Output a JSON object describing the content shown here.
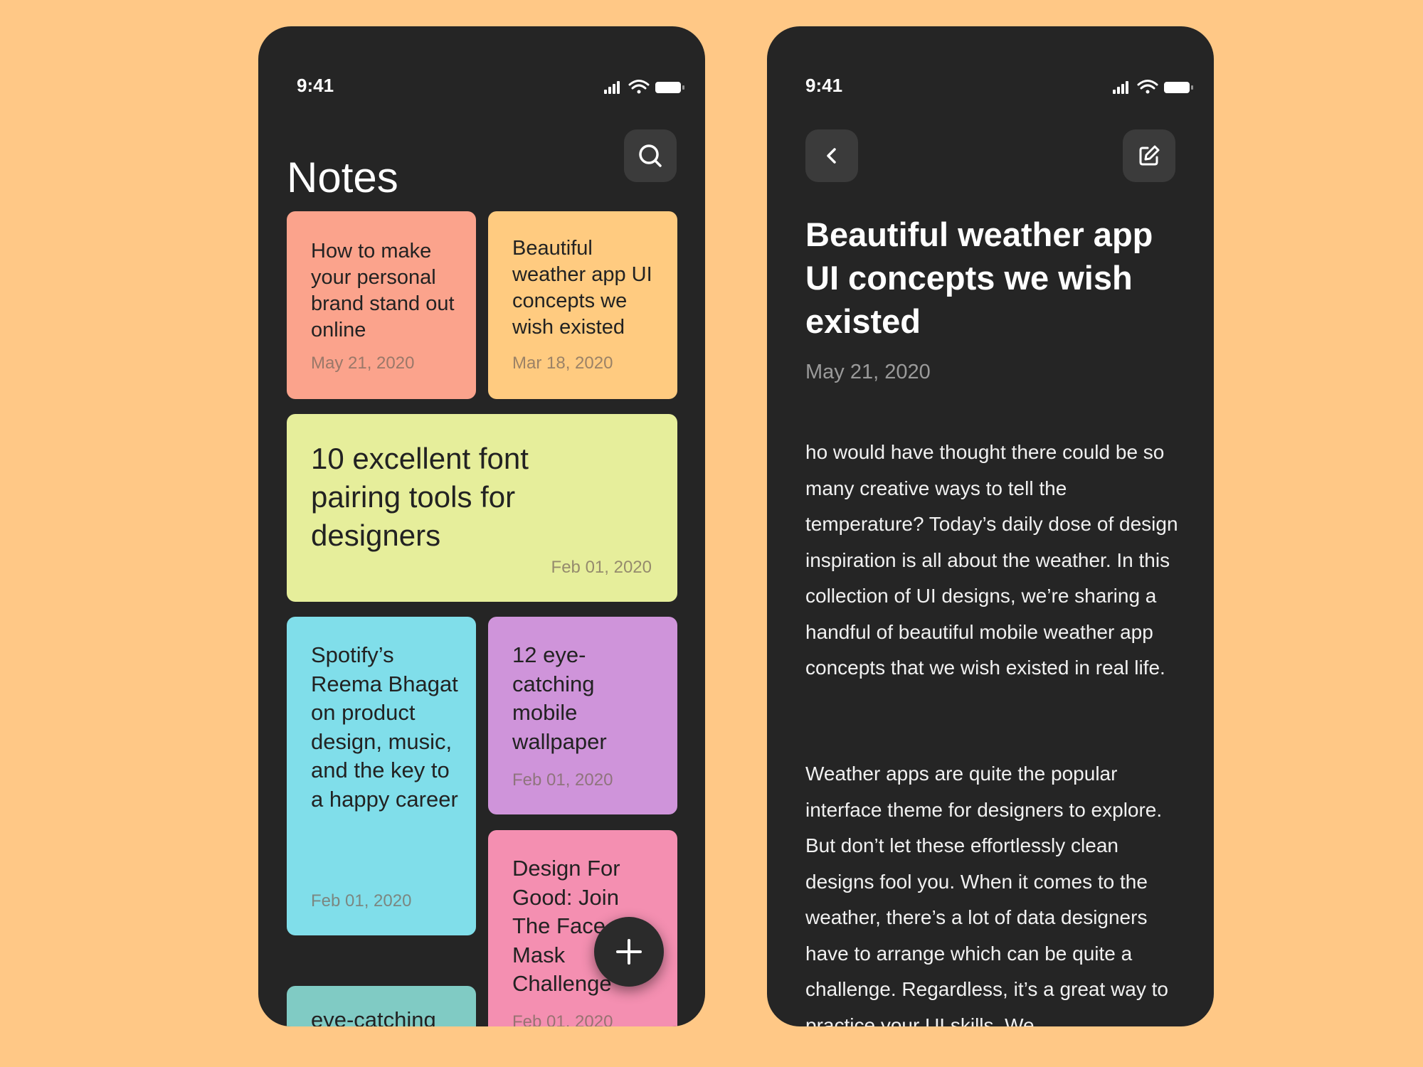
{
  "list_screen": {
    "status": {
      "time": "9:41"
    },
    "title": "Notes",
    "notes": [
      {
        "title": "How to make your personal brand stand out online",
        "date": "May 21, 2020",
        "color": "#FBA38C"
      },
      {
        "title": "Beautiful weather app UI concepts we wish existed",
        "date": "Mar 18, 2020",
        "color": "#FFCB80"
      },
      {
        "title": "10 excellent font pairing tools for designers",
        "date": "Feb 01, 2020",
        "color": "#E6EE9B"
      },
      {
        "title": "Spotify’s Reema Bhagat on product design, music, and the key to a happy career",
        "date": "Feb 01, 2020",
        "color": "#80DEEA"
      },
      {
        "title": "12 eye-catching mobile wallpaper",
        "date": "Feb 01, 2020",
        "color": "#CF94DA"
      },
      {
        "title": "Design For Good: Join The Face Mask Challenge",
        "date": "Feb 01, 2020",
        "color": "#F48FB1"
      },
      {
        "title": "eye-catching mobile",
        "date": "",
        "color": "#80CBC4"
      }
    ],
    "fab_icon": "plus-icon"
  },
  "detail_screen": {
    "status": {
      "time": "9:41"
    },
    "title": "Beautiful weather app UI concepts we wish existed",
    "date": "May 21, 2020",
    "paragraphs": [
      "ho would have thought there could be so many creative ways to tell the temperature? Today’s daily dose of design inspiration is all about the weather. In this collection of UI designs, we’re sharing a handful of beautiful mobile weather app concepts that we wish existed in real life.",
      "Weather apps are quite the popular interface theme for designers to explore. But don’t let these effortlessly clean designs fool you. When it comes to the weather, there’s a lot of data designers have to arrange which can be quite a challenge. Regardless, it’s a great way to practice your UI skills. We"
    ]
  },
  "colors": {
    "background": "#FFC886",
    "phone": "#252525",
    "button": "#3B3B3B"
  }
}
